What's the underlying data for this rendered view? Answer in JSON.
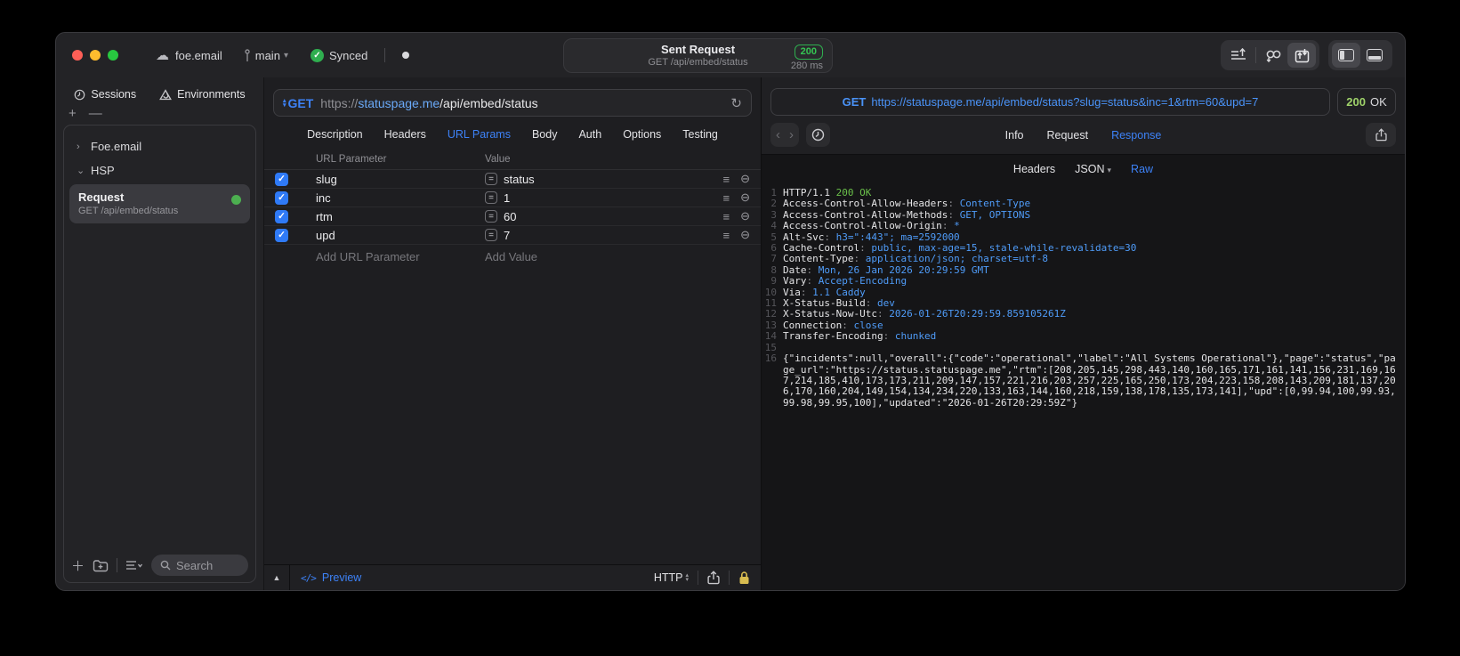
{
  "titlebar": {
    "project": "foe.email",
    "branch": "main",
    "sync_label": "Synced",
    "center": {
      "title": "Sent Request",
      "subtitle": "GET /api/embed/status",
      "status_code": "200",
      "duration": "280 ms"
    }
  },
  "sidebar": {
    "tabs": [
      {
        "label": "Sessions",
        "icon": "clock-icon"
      },
      {
        "label": "Environments",
        "icon": "environments-icon"
      }
    ],
    "plus": "+",
    "minus": "—",
    "tree": [
      {
        "label": "Foe.email",
        "caret": "›"
      },
      {
        "label": "HSP",
        "caret": "⌄"
      }
    ],
    "request_item": {
      "title": "Request",
      "subtitle": "GET /api/embed/status"
    },
    "search_placeholder": "Search"
  },
  "request_panel": {
    "method": "GET",
    "url": {
      "scheme": "https://",
      "host": "statuspage.me",
      "path": "/api/embed/status"
    },
    "tabs": [
      "Description",
      "Headers",
      "URL Params",
      "Body",
      "Auth",
      "Options",
      "Testing"
    ],
    "active_tab": "URL Params",
    "params_table": {
      "columns": [
        "URL Parameter",
        "Value"
      ],
      "rows": [
        {
          "enabled": true,
          "name": "slug",
          "operator": "=",
          "value": "status"
        },
        {
          "enabled": true,
          "name": "inc",
          "operator": "=",
          "value": "1"
        },
        {
          "enabled": true,
          "name": "rtm",
          "operator": "=",
          "value": "60"
        },
        {
          "enabled": true,
          "name": "upd",
          "operator": "=",
          "value": "7"
        }
      ],
      "add_param_placeholder": "Add URL Parameter",
      "add_value_placeholder": "Add Value"
    },
    "footer": {
      "preview_label": "Preview",
      "code_glyph": "</>",
      "protocol": "HTTP"
    }
  },
  "response_panel": {
    "request_line_method": "GET",
    "request_line_url": "https://statuspage.me/api/embed/status?slug=status&inc=1&rtm=60&upd=7",
    "status": {
      "code": "200",
      "text": "OK"
    },
    "tabs": [
      "Info",
      "Request",
      "Response"
    ],
    "active_tab": "Response",
    "subtabs": [
      "Headers",
      "JSON",
      "Raw"
    ],
    "active_subtab": "Raw",
    "status_line": {
      "protocol": "HTTP/1.1",
      "status": "200 OK"
    },
    "headers": [
      {
        "name": "Access-Control-Allow-Headers",
        "value": "Content-Type"
      },
      {
        "name": "Access-Control-Allow-Methods",
        "value": "GET, OPTIONS"
      },
      {
        "name": "Access-Control-Allow-Origin",
        "value": "*"
      },
      {
        "name": "Alt-Svc",
        "value": "h3=\":443\"; ma=2592000"
      },
      {
        "name": "Cache-Control",
        "value": "public, max-age=15, stale-while-revalidate=30"
      },
      {
        "name": "Content-Type",
        "value": "application/json; charset=utf-8"
      },
      {
        "name": "Date",
        "value": "Mon, 26 Jan 2026 20:29:59 GMT"
      },
      {
        "name": "Vary",
        "value": "Accept-Encoding"
      },
      {
        "name": "Via",
        "value": "1.1 Caddy"
      },
      {
        "name": "X-Status-Build",
        "value": "dev"
      },
      {
        "name": "X-Status-Now-Utc",
        "value": "2026-01-26T20:29:59.859105261Z"
      },
      {
        "name": "Connection",
        "value": "close"
      },
      {
        "name": "Transfer-Encoding",
        "value": "chunked"
      }
    ],
    "body_text": "{\"incidents\":null,\"overall\":{\"code\":\"operational\",\"label\":\"All Systems Operational\"},\"page\":\"status\",\"page_url\":\"https://status.statuspage.me\",\"rtm\":[208,205,145,298,443,140,160,165,171,161,141,156,231,169,167,214,185,410,173,173,211,209,147,157,221,216,203,257,225,165,250,173,204,223,158,208,143,209,181,137,206,170,160,204,149,154,134,234,220,133,163,144,160,218,159,138,178,135,173,141],\"upd\":[0,99.94,100,99.93,99.98,99.95,100],\"updated\":\"2026-01-26T20:29:59Z\"}"
  },
  "colors": {
    "accent_blue": "#3d82f7",
    "code_value_blue": "#4f9cf9",
    "status_green": "#35c653",
    "code_green": "#6ac04a",
    "checkbox_blue": "#2f7af7"
  }
}
